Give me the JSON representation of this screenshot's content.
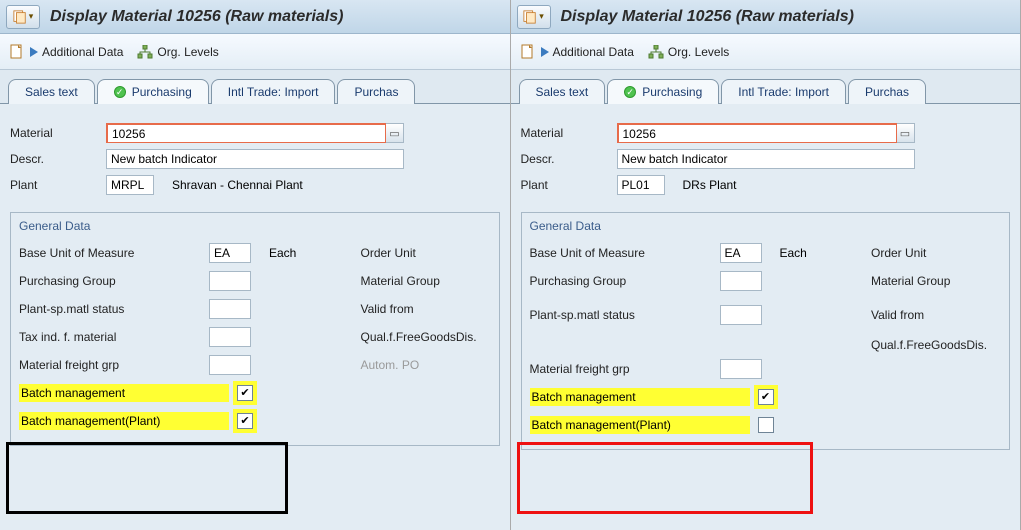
{
  "title": "Display Material 10256 (Raw materials)",
  "toolbar": {
    "additional_data": "Additional Data",
    "org_levels": "Org. Levels"
  },
  "tabs": {
    "sales_text": "Sales text",
    "purchasing": "Purchasing",
    "intl_trade_import": "Intl Trade: Import",
    "purchase": "Purchas"
  },
  "labels": {
    "material": "Material",
    "descr": "Descr.",
    "plant": "Plant",
    "general_data": "General Data",
    "base_uom": "Base Unit of Measure",
    "each": "Each",
    "order_unit": "Order Unit",
    "purchasing_group": "Purchasing Group",
    "material_group": "Material Group",
    "plant_sp_matl_status": "Plant-sp.matl status",
    "valid_from": "Valid from",
    "tax_ind": "Tax ind. f. material",
    "qual_free_goods": "Qual.f.FreeGoodsDis.",
    "material_freight_grp": "Material freight grp",
    "autom_po": "Autom. PO",
    "batch_management": "Batch management",
    "batch_management_plant": "Batch management(Plant)"
  },
  "left": {
    "material": "10256",
    "descr": "New batch Indicator",
    "plant_code": "MRPL",
    "plant_name": "Shravan - Chennai Plant",
    "base_uom": "EA",
    "batch_mgmt": true,
    "batch_mgmt_plant": true
  },
  "right": {
    "material": "10256",
    "descr": "New batch Indicator",
    "plant_code": "PL01",
    "plant_name": "DRs Plant",
    "base_uom": "EA",
    "batch_mgmt": true,
    "batch_mgmt_plant": false
  }
}
